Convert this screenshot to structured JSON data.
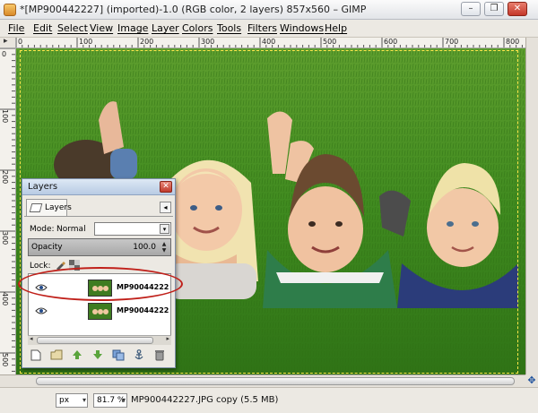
{
  "window": {
    "title": "*[MP900442227] (imported)-1.0 (RGB color, 2 layers) 857x560 – GIMP",
    "minimize_glyph": "–",
    "restore_glyph": "❐",
    "close_glyph": "✕"
  },
  "menubar": {
    "items": [
      {
        "label": "File"
      },
      {
        "label": "Edit"
      },
      {
        "label": "Select"
      },
      {
        "label": "View"
      },
      {
        "label": "Image"
      },
      {
        "label": "Layer"
      },
      {
        "label": "Colors"
      },
      {
        "label": "Tools"
      },
      {
        "label": "Filters"
      },
      {
        "label": "Windows"
      },
      {
        "label": "Help"
      }
    ]
  },
  "rulers": {
    "horizontal": [
      "0",
      "100",
      "200",
      "300",
      "400",
      "500",
      "600",
      "700",
      "800"
    ],
    "vertical": [
      "0",
      "100",
      "200",
      "300",
      "400",
      "500"
    ]
  },
  "status": {
    "unit": "px",
    "zoom": "81.7 %",
    "text": "MP900442227.JPG copy (5.5 MB)"
  },
  "layers_panel": {
    "title": "Layers",
    "close_glyph": "✕",
    "tab_label": "Layers",
    "tab_menu_glyph": "◂",
    "mode_label": "Mode:",
    "mode_value": "Normal",
    "opacity_label": "Opacity",
    "opacity_value": "100.0",
    "lock_label": "Lock:",
    "layers": [
      {
        "name": "MP900442227.",
        "visible": true,
        "selected": false
      },
      {
        "name": "MP900442227.",
        "visible": true,
        "selected": false
      }
    ],
    "toolbar_icons": [
      "new-layer-icon",
      "new-layer-group-icon",
      "raise-layer-icon",
      "lower-layer-icon",
      "duplicate-layer-icon",
      "anchor-layer-icon",
      "delete-layer-icon"
    ]
  },
  "colors": {
    "annotation": "#c0201a",
    "grass": "#3f8a1f",
    "selection": "#ffe64a"
  }
}
